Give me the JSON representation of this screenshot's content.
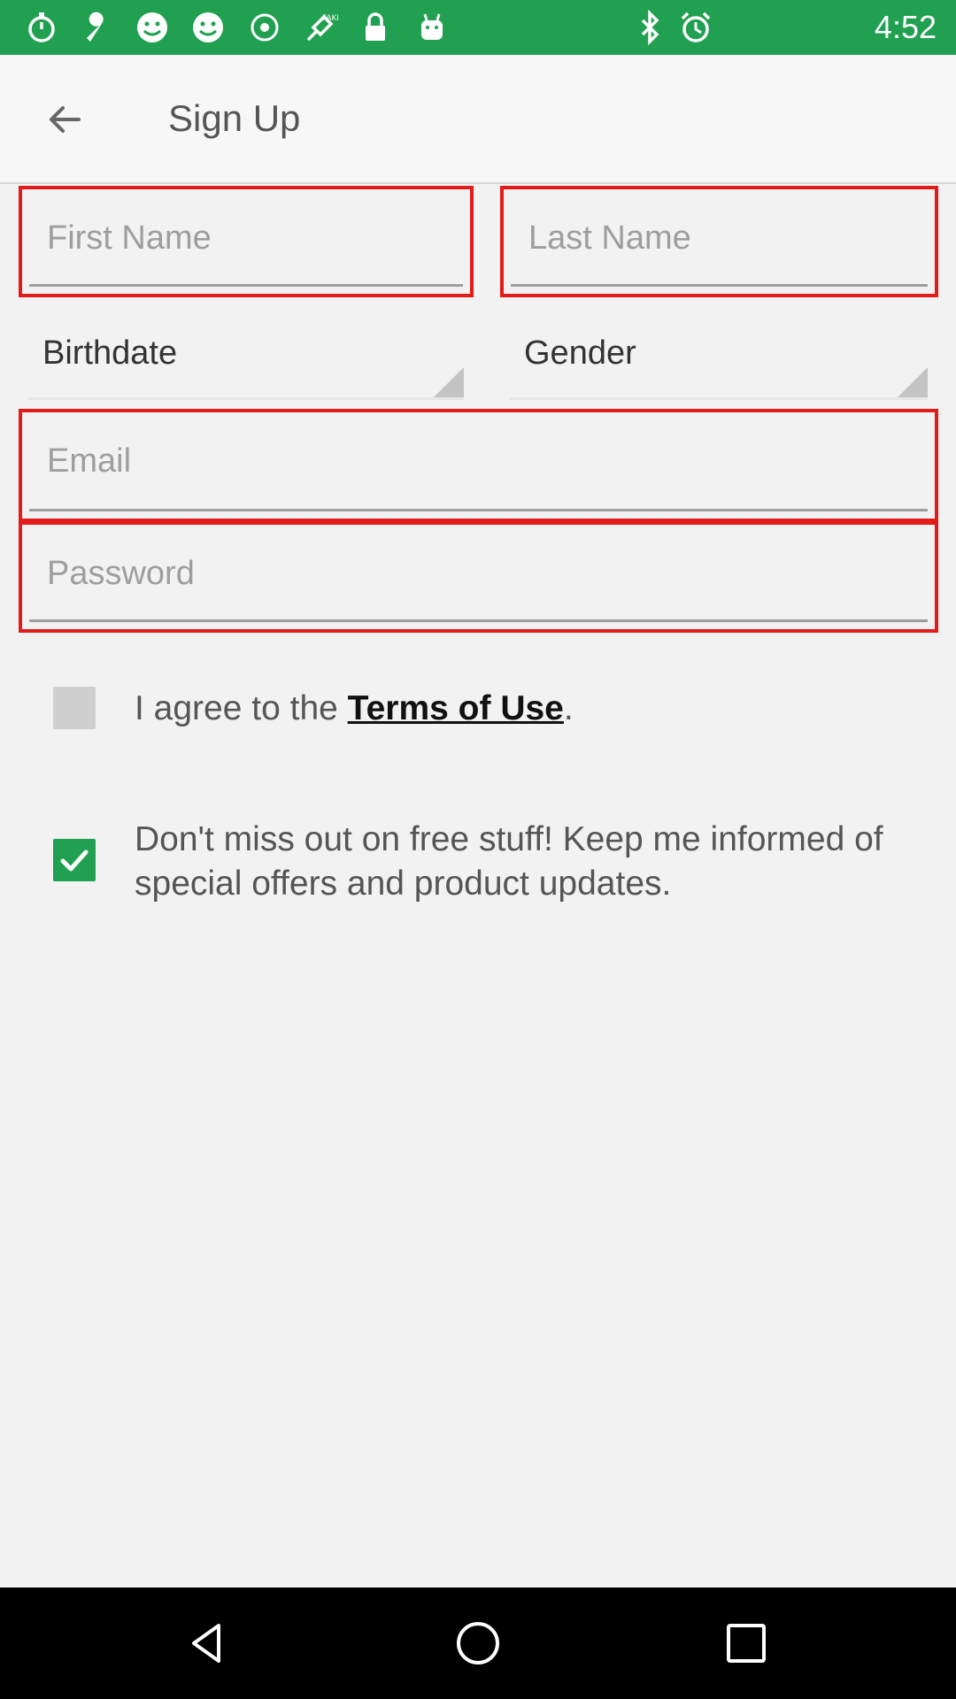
{
  "status_bar": {
    "time": "4:52",
    "bg_color": "#20a050",
    "left_icons": [
      "stopwatch-icon",
      "wrench-icon",
      "smiley-icon",
      "smiley-icon",
      "signal-icon",
      "fake-gps-icon",
      "lock-icon",
      "android-icon"
    ],
    "right_icons": [
      "bluetooth-icon",
      "alarm-icon"
    ]
  },
  "app_bar": {
    "title": "Sign Up",
    "back_icon": "arrow-left-icon"
  },
  "form": {
    "first_name": {
      "placeholder": "First Name",
      "value": ""
    },
    "last_name": {
      "placeholder": "Last Name",
      "value": ""
    },
    "birthdate": {
      "label": "Birthdate"
    },
    "gender": {
      "label": "Gender"
    },
    "email": {
      "placeholder": "Email",
      "value": ""
    },
    "password": {
      "placeholder": "Password",
      "value": ""
    },
    "error_border_color": "#e21b1b"
  },
  "terms": {
    "checked": false,
    "prefix": "I agree to the ",
    "link": "Terms of Use",
    "suffix": "."
  },
  "offers": {
    "checked": true,
    "text": "Don't miss out on free stuff! Keep me informed of special offers and product updates.",
    "check_color": "#20a050"
  },
  "nav_bar": {
    "buttons": [
      "back-triangle-icon",
      "home-circle-icon",
      "recents-square-icon"
    ]
  }
}
